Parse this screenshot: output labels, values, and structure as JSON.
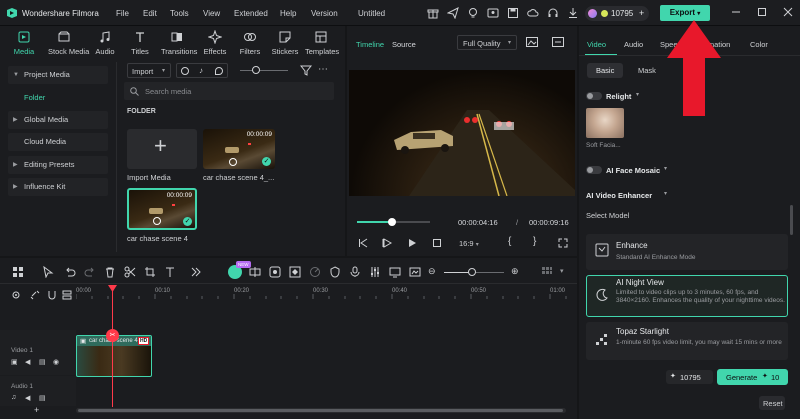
{
  "app": {
    "title": "Wondershare Filmora",
    "project": "Untitled"
  },
  "menu": [
    "File",
    "Edit",
    "Tools",
    "View",
    "Extended",
    "Help",
    "Version"
  ],
  "credits": {
    "value": "10795",
    "plus": "+"
  },
  "export_label": "Export",
  "media_tabs": [
    "Media",
    "Stock Media",
    "Audio",
    "Titles",
    "Transitions",
    "Effects",
    "Filters",
    "Stickers",
    "Templates"
  ],
  "sidebar": {
    "items": [
      "Project Media",
      "Folder",
      "Global Media",
      "Cloud Media",
      "Editing Presets",
      "Influence Kit"
    ]
  },
  "library": {
    "import_label": "Import",
    "search_placeholder": "Search media",
    "folder_heading": "FOLDER",
    "tiles": [
      {
        "label": "Import Media",
        "duration": ""
      },
      {
        "label": "car chase scene 4_...",
        "duration": "00:00:09"
      },
      {
        "label": "car chase scene 4",
        "duration": "00:00:09"
      }
    ]
  },
  "preview": {
    "tabs": [
      "Timeline",
      "Source"
    ],
    "quality": "Full Quality",
    "current_time": "00:00:04:16",
    "separator": "/",
    "total_time": "00:00:09:16",
    "ratio": "16:9",
    "progress": 0.48
  },
  "props": {
    "tabs": [
      "Video",
      "Audio",
      "Speed",
      "Animation",
      "Color"
    ],
    "subtabs": [
      "Basic",
      "Mask"
    ],
    "relight_label": "Relight",
    "relight_thumb_caption": "Soft Facia...",
    "face_mosaic_label": "AI Face Mosaic",
    "enhancer_label": "AI Video Enhancer",
    "select_model_label": "Select Model",
    "models": [
      {
        "title": "Enhance",
        "desc": "Standard AI Enhance Mode"
      },
      {
        "title": "AI Night View",
        "desc": "Limited to video clips up to 3 minutes, 60 fps, and 3840×2160. Enhances the quality of your nighttime videos."
      },
      {
        "title": "Topaz Starlight",
        "desc": "1-minute 60 fps video limit, you may wait 15 mins or more"
      }
    ],
    "credit_cost": "10795",
    "generate_label": "Generate",
    "generate_cost": "10",
    "reset_label": "Reset"
  },
  "timeline": {
    "ruler": [
      "00:00",
      "00:10",
      "00:20",
      "00:30",
      "00:40",
      "00:50",
      "01:00"
    ],
    "tracks": [
      "Video 1",
      "Audio 1"
    ],
    "clip_label": "car chase scene 4",
    "hd_badge": "HD",
    "new_badge": "NEW"
  },
  "colors": {
    "accent": "#41d6ad",
    "arrow": "#e8182b",
    "bg": "#1b1c1f"
  }
}
